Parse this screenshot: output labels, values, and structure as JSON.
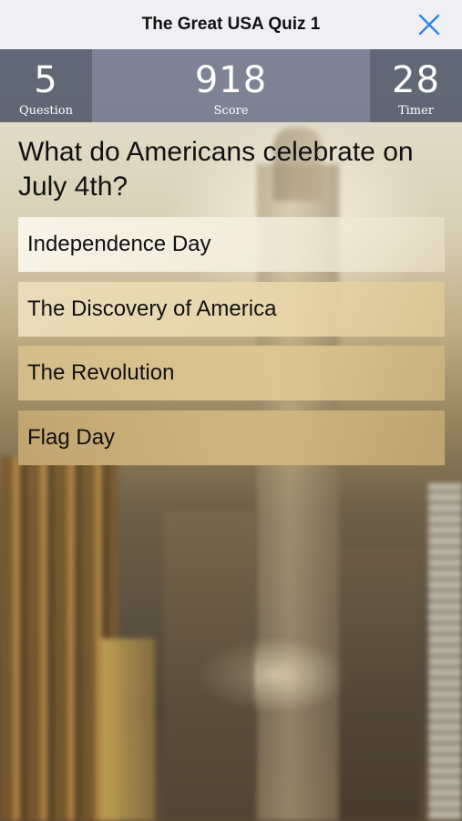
{
  "header": {
    "title": "The Great USA Quiz 1",
    "close_icon": "close-icon",
    "close_color": "#2f80ed"
  },
  "stats": {
    "question": {
      "value": "5",
      "label": "Question"
    },
    "score": {
      "value": "918",
      "label": "Score"
    },
    "timer": {
      "value": "28",
      "label": "Timer"
    }
  },
  "quiz": {
    "question": "What do Americans celebrate on July 4th?",
    "answers": [
      "Independence Day",
      "The Discovery of America",
      "The Revolution",
      "Flag Day"
    ]
  }
}
